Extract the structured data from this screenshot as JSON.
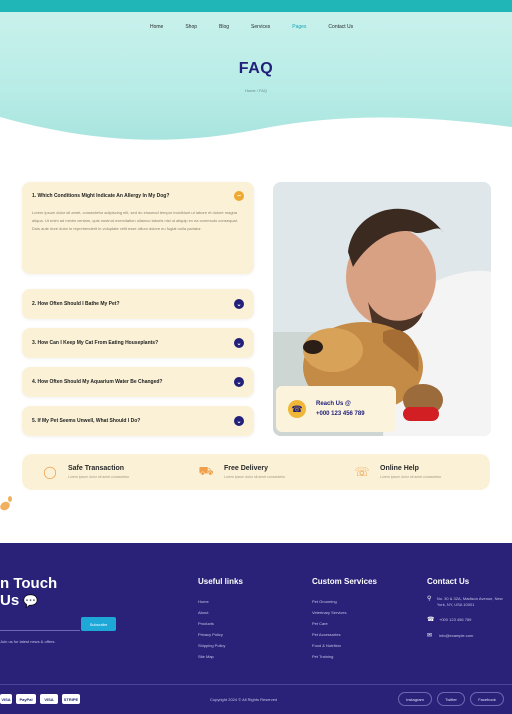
{
  "topbar": {
    "left_text": "",
    "right_text": ""
  },
  "nav": {
    "items": [
      "Home",
      "Shop",
      "Blog",
      "Services",
      "Pages",
      "Contact Us"
    ],
    "active_index": 4
  },
  "hero": {
    "title": "FAQ",
    "breadcrumb": "Home / FAQ"
  },
  "faq": {
    "open": {
      "question": "1. Which Conditions Might Indicate An Allergy In My Dog?",
      "answer": "Lorem ipsum dolor sit amet, consectetur adipiscing elit, sed do eiusmod tempor incididunt ut labore et dolore magna aliqua. Ut enim ad minim veniam, quis nostrud exercitation ullamco laboris nisi ut aliquip ex ea commodo consequat. Duis aute irure dolor in reprehenderit in voluptate velit esse cillum dolore eu fugiat nulla pariatur."
    },
    "items": [
      "2. How Often Should I Bathe My Pet?",
      "3. How Can I Keep My Cat From Eating Houseplants?",
      "4. How Often Should My Aquarium Water Be Changed?",
      "5. If My Pet Seems Unwell, What Should I Do?"
    ]
  },
  "reach": {
    "label": "Reach Us @",
    "phone": "+000 123 456 789"
  },
  "features": [
    {
      "title": "Safe Transaction",
      "subtitle": "Lorem ipsum dolor sit amet consectetur",
      "icon": "shield-icon"
    },
    {
      "title": "Free Delivery",
      "subtitle": "Lorem ipsum dolor sit amet consectetur",
      "icon": "truck-icon"
    },
    {
      "title": "Online Help",
      "subtitle": "Lorem ipsum dolor sit amet consectetur",
      "icon": "headset-icon"
    }
  ],
  "footer": {
    "heading_line1": "n Touch",
    "heading_line2": "Us",
    "subscribe_button": "Subscribe",
    "newsletter_note": "Join us for latest news & offers.",
    "useful_links": {
      "title": "Useful links",
      "items": [
        "Home",
        "About",
        "Products",
        "Privacy Policy",
        "Shipping Policy",
        "Site Map"
      ]
    },
    "custom_services": {
      "title": "Custom Services",
      "items": [
        "Pet Grooming",
        "Veterinary Services",
        "Pet Care",
        "Pet Accessories",
        "Food & Nutrition",
        "Pet Training"
      ]
    },
    "contact": {
      "title": "Contact Us",
      "address": "No. 30 & 32A, Madison Avenue, New York, NY, USA 10001",
      "phone": "+000 123 456 789",
      "email": "info@example.com"
    },
    "payments": [
      "VISA",
      "PayPal",
      "VISA",
      "STRIPE"
    ],
    "copyright": "Copyright 2024 © All Rights Reserved",
    "pills": [
      "Instagram",
      "Twitter",
      "Facebook"
    ]
  },
  "colors": {
    "navy": "#22207a",
    "teal": "#20b6b8",
    "cream": "#faf1d6",
    "accent": "#f0a830",
    "footer": "#2a2278"
  }
}
